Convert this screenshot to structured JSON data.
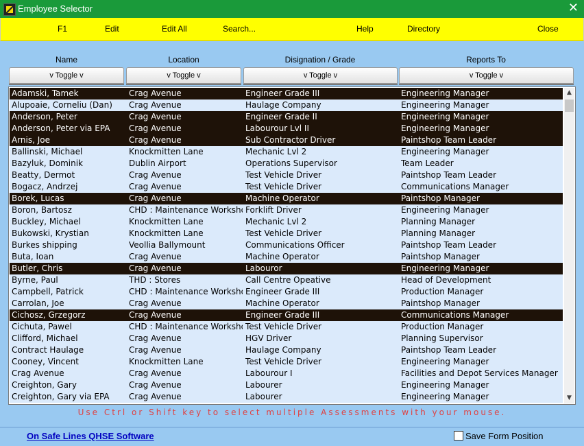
{
  "window": {
    "title": "Employee Selector",
    "close_glyph": "✕"
  },
  "menu": {
    "f1": "F1",
    "edit": "Edit",
    "edit_all": "Edit All",
    "search": "Search...",
    "help": "Help",
    "directory": "Directory",
    "close": "Close"
  },
  "columns": {
    "name": "Name",
    "location": "Location",
    "designation": "Disignation / Grade",
    "reports_to": "Reports To"
  },
  "toggle_label": "v Toggle v",
  "colors": {
    "title_bar": "#1a9a3a",
    "menu_bar": "#ffff00",
    "selected_row": "#1e1208",
    "row_bg": "#dbeafb",
    "hint_text": "#e04040"
  },
  "rows": [
    {
      "name": "Adamski, Tamek",
      "location": "Crag Avenue",
      "designation": "Engineer Grade III",
      "reports_to": "Engineering Manager",
      "selected": true
    },
    {
      "name": "Alupoaie, Corneliu (Dan)",
      "location": "Crag Avenue",
      "designation": "Haulage Company",
      "reports_to": "Engineering Manager",
      "selected": false
    },
    {
      "name": "Anderson, Peter",
      "location": "Crag Avenue",
      "designation": "Engineer Grade II",
      "reports_to": "Engineering Manager",
      "selected": true
    },
    {
      "name": "Anderson, Peter via EPA",
      "location": "Crag Avenue",
      "designation": "Labourour Lvl II",
      "reports_to": "Engineering Manager",
      "selected": true
    },
    {
      "name": "Arnis, Joe",
      "location": "Crag Avenue",
      "designation": "Sub Contractor Driver",
      "reports_to": "Paintshop Team Leader",
      "selected": true
    },
    {
      "name": "Ballinski, Michael",
      "location": "Knockmitten Lane",
      "designation": "Mechanic Lvl 2",
      "reports_to": "Engineering Manager",
      "selected": false
    },
    {
      "name": "Bazyluk, Dominik",
      "location": "Dublin Airport",
      "designation": "Operations Supervisor",
      "reports_to": "Team Leader",
      "selected": false
    },
    {
      "name": "Beatty, Dermot",
      "location": "Crag Avenue",
      "designation": "Test Vehicle Driver",
      "reports_to": "Paintshop Team Leader",
      "selected": false
    },
    {
      "name": "Bogacz, Andrzej",
      "location": "Crag Avenue",
      "designation": "Test Vehicle Driver",
      "reports_to": "Communications Manager",
      "selected": false
    },
    {
      "name": "Borek, Lucas",
      "location": "Crag Avenue",
      "designation": "Machine Operator",
      "reports_to": "Paintshop Manager",
      "selected": true
    },
    {
      "name": "Boron, Bartosz",
      "location": "CHD : Maintenance Workshop",
      "designation": "Forklift Driver",
      "reports_to": "Engineering Manager",
      "selected": false
    },
    {
      "name": "Buckley, Michael",
      "location": "Knockmitten Lane",
      "designation": "Mechanic Lvl 2",
      "reports_to": "Planning Manager",
      "selected": false
    },
    {
      "name": "Bukowski, Krystian",
      "location": "Knockmitten Lane",
      "designation": "Test Vehicle Driver",
      "reports_to": "Planning Manager",
      "selected": false
    },
    {
      "name": "Burkes shipping",
      "location": "Veollia Ballymount",
      "designation": "Communications Officer",
      "reports_to": "Paintshop Team Leader",
      "selected": false
    },
    {
      "name": "Buta, Ioan",
      "location": "Crag Avenue",
      "designation": "Machine Operator",
      "reports_to": "Paintshop Manager",
      "selected": false
    },
    {
      "name": "Butler, Chris",
      "location": "Crag Avenue",
      "designation": "Labouror",
      "reports_to": "Engineering Manager",
      "selected": true
    },
    {
      "name": "Byrne, Paul",
      "location": "THD : Stores",
      "designation": "Call Centre Opeative",
      "reports_to": "Head of Development",
      "selected": false
    },
    {
      "name": "Campbell, Patrick",
      "location": "CHD : Maintenance Workshop",
      "designation": "Engineer Grade III",
      "reports_to": "Production Manager",
      "selected": false
    },
    {
      "name": "Carrolan, Joe",
      "location": "Crag Avenue",
      "designation": "Machine Operator",
      "reports_to": "Paintshop Manager",
      "selected": false
    },
    {
      "name": "Cichosz, Grzegorz",
      "location": "Crag Avenue",
      "designation": "Engineer Grade III",
      "reports_to": "Communications Manager",
      "selected": true
    },
    {
      "name": "Cichuta, Pawel",
      "location": "CHD : Maintenance Workshop",
      "designation": "Test Vehicle Driver",
      "reports_to": "Production Manager",
      "selected": false
    },
    {
      "name": "Clifford, Michael",
      "location": "Crag Avenue",
      "designation": "HGV Driver",
      "reports_to": "Planning Supervisor",
      "selected": false
    },
    {
      "name": "Contract Haulage",
      "location": "Crag Avenue",
      "designation": "Haulage Company",
      "reports_to": "Paintshop Team Leader",
      "selected": false
    },
    {
      "name": "Cooney, Vincent",
      "location": "Knockmitten Lane",
      "designation": "Test Vehicle Driver",
      "reports_to": "Engineering Manager",
      "selected": false
    },
    {
      "name": "Crag Avenue",
      "location": "Crag Avenue",
      "designation": "Labourour I",
      "reports_to": "Facilities and Depot Services Manager",
      "selected": false
    },
    {
      "name": "Creighton, Gary",
      "location": "Crag Avenue",
      "designation": "Labourer",
      "reports_to": "Engineering Manager",
      "selected": false
    },
    {
      "name": "Creighton, Gary via EPA",
      "location": "Crag Avenue",
      "designation": "Labourer",
      "reports_to": "Engineering Manager",
      "selected": false
    }
  ],
  "scrollbar": {
    "up_glyph": "▲",
    "down_glyph": "▼"
  },
  "hint": "Use Ctrl or Shift key to select multiple Assessments with your mouse.",
  "footer": {
    "link": "On Safe Lines QHSE Software",
    "save_position": "Save Form Position",
    "save_position_checked": false
  }
}
